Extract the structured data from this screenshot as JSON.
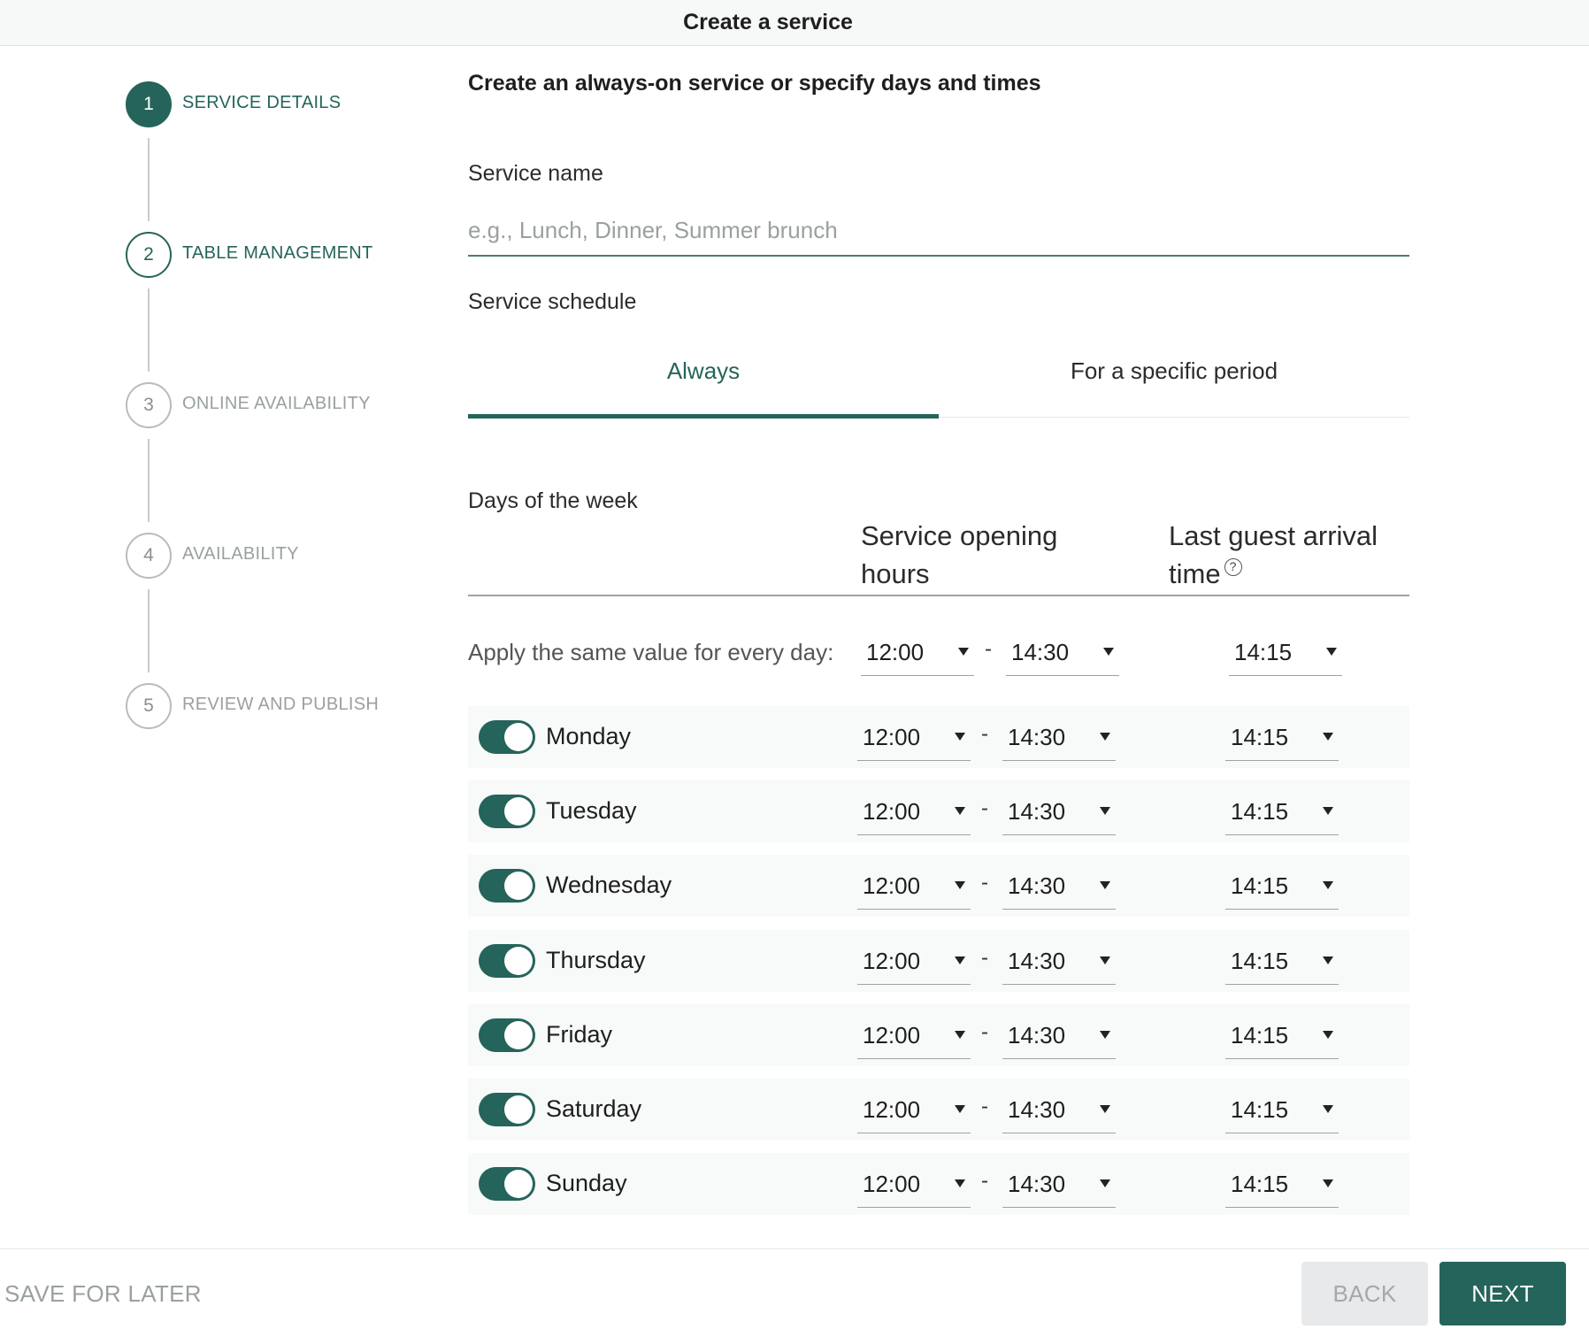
{
  "header": {
    "title": "Create a service"
  },
  "stepper": {
    "steps": [
      {
        "number": "1",
        "label": "SERVICE DETAILS"
      },
      {
        "number": "2",
        "label": "TABLE MANAGEMENT"
      },
      {
        "number": "3",
        "label": "ONLINE AVAILABILITY"
      },
      {
        "number": "4",
        "label": "AVAILABILITY"
      },
      {
        "number": "5",
        "label": "REVIEW AND PUBLISH"
      }
    ]
  },
  "form": {
    "heading": "Create an always-on service or specify days and times",
    "service_name_label": "Service name",
    "service_name_value": "",
    "service_name_placeholder": "e.g., Lunch, Dinner, Summer brunch",
    "schedule_label": "Service schedule",
    "tabs": [
      {
        "label": "Always",
        "active": true
      },
      {
        "label": "For a specific period",
        "active": false
      }
    ],
    "days_label": "Days of the week",
    "col_hours": "Service opening hours",
    "col_last": "Last guest arrival time",
    "help_icon": "?",
    "apply_label": "Apply the same value for every day:",
    "apply": {
      "open": "12:00",
      "close": "14:30",
      "last": "14:15"
    },
    "days": [
      {
        "name": "Monday",
        "enabled": true,
        "open": "12:00",
        "close": "14:30",
        "last": "14:15"
      },
      {
        "name": "Tuesday",
        "enabled": true,
        "open": "12:00",
        "close": "14:30",
        "last": "14:15"
      },
      {
        "name": "Wednesday",
        "enabled": true,
        "open": "12:00",
        "close": "14:30",
        "last": "14:15"
      },
      {
        "name": "Thursday",
        "enabled": true,
        "open": "12:00",
        "close": "14:30",
        "last": "14:15"
      },
      {
        "name": "Friday",
        "enabled": true,
        "open": "12:00",
        "close": "14:30",
        "last": "14:15"
      },
      {
        "name": "Saturday",
        "enabled": true,
        "open": "12:00",
        "close": "14:30",
        "last": "14:15"
      },
      {
        "name": "Sunday",
        "enabled": true,
        "open": "12:00",
        "close": "14:30",
        "last": "14:15"
      }
    ],
    "separator": "-"
  },
  "footer": {
    "save_label": "SAVE FOR LATER",
    "back_label": "BACK",
    "next_label": "NEXT"
  },
  "colors": {
    "accent": "#25645a",
    "muted": "#9aa0a0",
    "row_bg": "#f8f9f9"
  },
  "icons": {
    "help": "question-circle-icon",
    "caret": "caret-down-icon"
  }
}
